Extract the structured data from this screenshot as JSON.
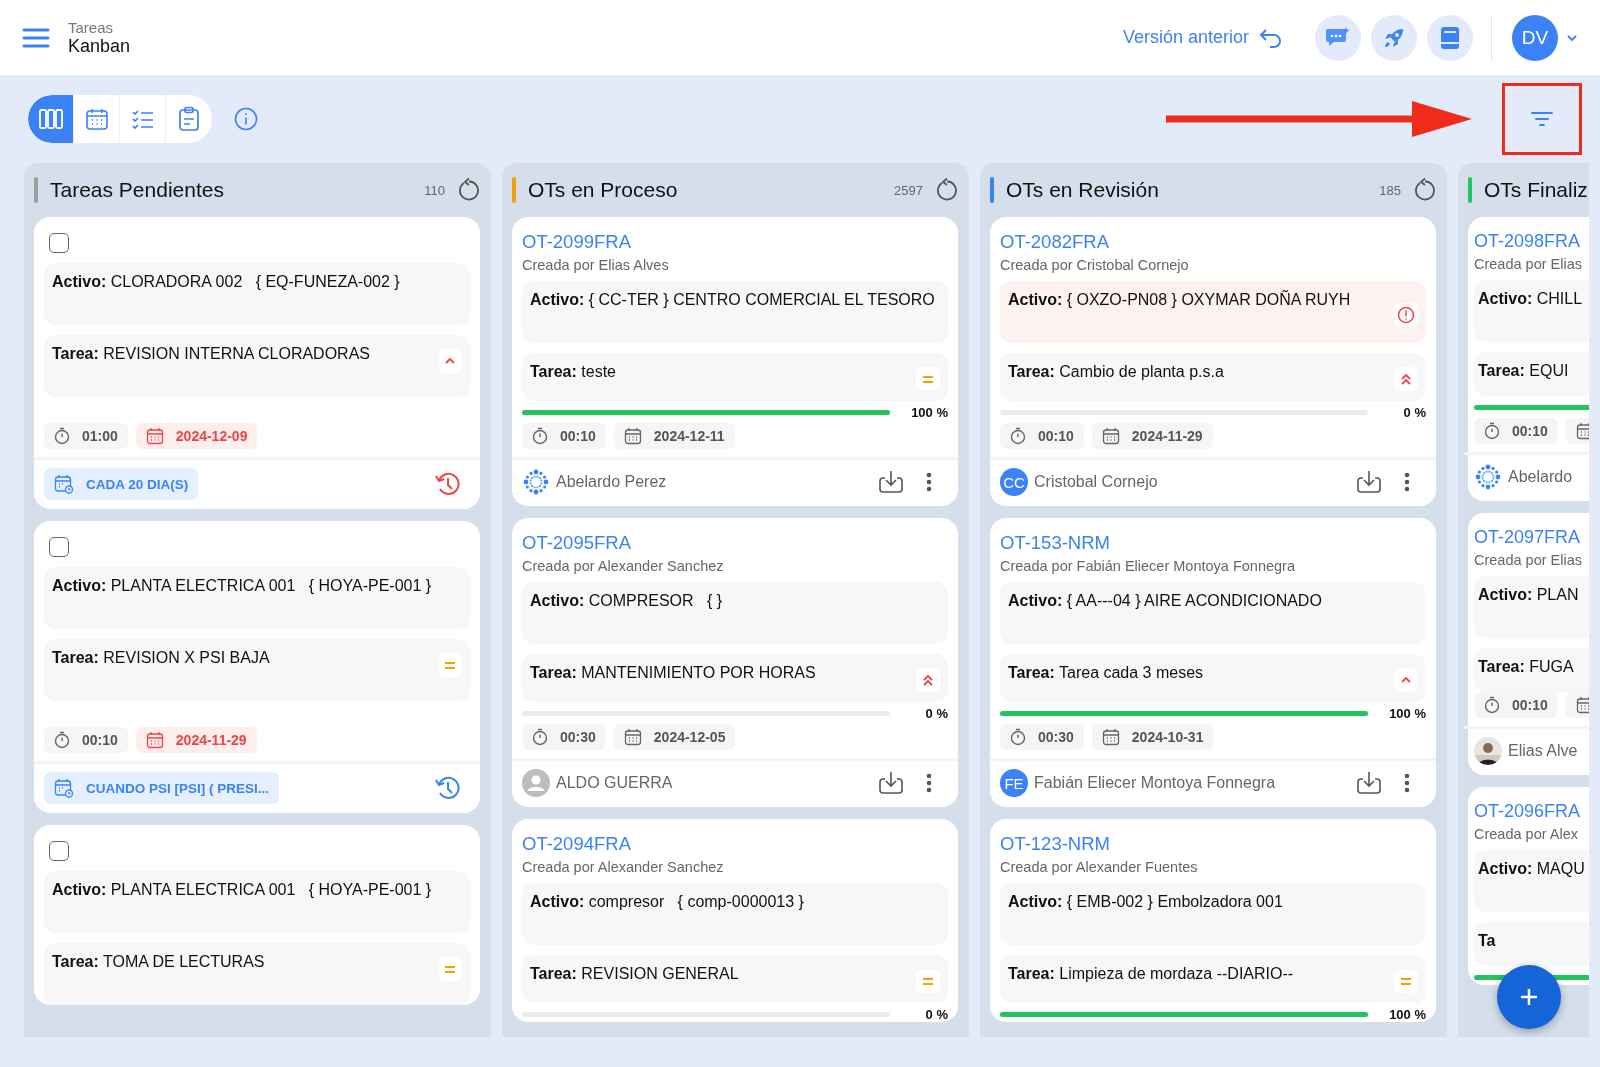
{
  "header": {
    "section": "Tareas",
    "title": "Kanban",
    "previous_version": "Versión anterior",
    "user_initials": "DV"
  },
  "toolbar": {
    "views": [
      {
        "kind": "board",
        "selected": true
      },
      {
        "kind": "calendar",
        "selected": false
      },
      {
        "kind": "checklist",
        "selected": false
      },
      {
        "kind": "clipboard",
        "selected": false
      }
    ]
  },
  "columns": [
    {
      "title": "Tareas Pendientes",
      "count": "110",
      "color": "#9e9e9e",
      "cards": [
        {
          "kind": "task",
          "checked": false,
          "activo": {
            "label": "Activo:",
            "value": "CLORADORA 002   { EQ-FUNEZA-002 }",
            "alert": false
          },
          "tarea": {
            "label": "Tarea:",
            "value": "REVISION INTERNA CLORADORAS",
            "kind": "up"
          },
          "time": "01:00",
          "date": "2024-12-09",
          "overdue": true,
          "recurrence": "CADA 20 DIA(S)",
          "history_alert": true
        },
        {
          "kind": "task",
          "checked": false,
          "activo": {
            "label": "Activo:",
            "value": "PLANTA ELECTRICA 001   { HOYA-PE-001 }",
            "alert": false
          },
          "tarea": {
            "label": "Tarea:",
            "value": "REVISION X PSI BAJA",
            "kind": "medium"
          },
          "time": "00:10",
          "date": "2024-11-29",
          "overdue": true,
          "recurrence": "CUANDO PSI [PSI] ( PRESI...",
          "history_alert": false
        },
        {
          "kind": "task",
          "checked": false,
          "activo": {
            "label": "Activo:",
            "value": "PLANTA ELECTRICA 001   { HOYA-PE-001 }",
            "alert": false
          },
          "tarea": {
            "label": "Tarea:",
            "value": "TOMA DE LECTURAS",
            "kind": "medium"
          }
        }
      ]
    },
    {
      "title": "OTs en Proceso",
      "count": "2597",
      "color": "#f59e0b",
      "cards": [
        {
          "kind": "order",
          "code": "OT-2099FRA",
          "creator": "Creada por Elias Alves",
          "activo": {
            "label": "Activo:",
            "value": "{ CC-TER } CENTRO COMERCIAL EL TESORO",
            "alert": false
          },
          "tarea": {
            "label": "Tarea:",
            "value": "teste",
            "kind": "medium"
          },
          "level": 1,
          "percent": "100 %",
          "time": "00:10",
          "date": "2024-12-11",
          "overdue": false,
          "assignee": {
            "kind": "dots",
            "name": "Abelardo Perez"
          },
          "actions": true
        },
        {
          "kind": "order",
          "code": "OT-2095FRA",
          "creator": "Creada por Alexander Sanchez",
          "activo": {
            "label": "Activo:",
            "value": "COMPRESOR   { }",
            "alert": false
          },
          "tarea": {
            "label": "Tarea:",
            "value": "MANTENIMIENTO POR HORAS",
            "kind": "high"
          },
          "level": 0,
          "percent": "0 %",
          "time": "00:30",
          "date": "2024-12-05",
          "overdue": false,
          "assignee": {
            "kind": "person",
            "name": "ALDO GUERRA"
          },
          "actions": true
        },
        {
          "kind": "order",
          "code": "OT-2094FRA",
          "creator": "Creada por Alexander Sanchez",
          "activo": {
            "label": "Activo:",
            "value": "compresor   { comp-0000013 }",
            "alert": false
          },
          "tarea": {
            "label": "Tarea:",
            "value": "REVISION GENERAL",
            "kind": "medium"
          },
          "level": 0,
          "percent": "0 %"
        }
      ]
    },
    {
      "title": "OTs en Revisión",
      "count": "185",
      "color": "#3b82f6",
      "cards": [
        {
          "kind": "order",
          "code": "OT-2082FRA",
          "creator": "Creada por Cristobal Cornejo",
          "activo": {
            "label": "Activo:",
            "value": "{ OXZO-PN08 } OXYMAR DOÑA RUYH",
            "alert": true
          },
          "tarea": {
            "label": "Tarea:",
            "value": "Cambio de planta p.s.a",
            "kind": "high"
          },
          "level": 0,
          "percent": "0 %",
          "time": "00:10",
          "date": "2024-11-29",
          "overdue": false,
          "assignee": {
            "kind": "initials",
            "initials": "CC",
            "name": "Cristobal Cornejo"
          },
          "actions": true
        },
        {
          "kind": "order",
          "code": "OT-153-NRM",
          "creator": "Creada por Fabián Eliecer Montoya Fonnegra",
          "activo": {
            "label": "Activo:",
            "value": "{ AA---04 } AIRE ACONDICIONADO",
            "alert": false
          },
          "tarea": {
            "label": "Tarea:",
            "value": "Tarea cada 3 meses",
            "kind": "up"
          },
          "level": 1,
          "percent": "100 %",
          "time": "00:30",
          "date": "2024-10-31",
          "overdue": false,
          "assignee": {
            "kind": "initials",
            "initials": "FE",
            "name": "Fabián Eliecer Montoya Fonnegra"
          },
          "actions": true
        },
        {
          "kind": "order",
          "code": "OT-123-NRM",
          "creator": "Creada por Alexander Fuentes",
          "activo": {
            "label": "Activo:",
            "value": "{ EMB-002 } Embolzadora 001",
            "alert": false
          },
          "tarea": {
            "label": "Tarea:",
            "value": "Limpieza de mordaza --DIARIO--",
            "kind": "medium"
          },
          "level": 1,
          "percent": "100 %"
        }
      ]
    },
    {
      "title": "OTs Finaliz",
      "color": "#22c55e",
      "cards": [
        {
          "kind": "order",
          "code": "OT-2098FRA",
          "creator": "Creada por Elias",
          "activo": {
            "label": "Activo:",
            "value": "CHILL"
          },
          "tarea": {
            "label": "Tarea:",
            "value": "EQUI"
          },
          "level": 1,
          "time": "00:10",
          "overdue": false,
          "assignee": {
            "kind": "dots",
            "name": "Abelardo"
          }
        },
        {
          "kind": "order",
          "code": "OT-2097FRA",
          "creator": "Creada por Elias",
          "activo": {
            "label": "Activo:",
            "value": "PLAN"
          },
          "tarea": {
            "label": "Tarea:",
            "value": "FUGA"
          },
          "time": "00:10",
          "overdue": false,
          "assignee": {
            "name": "Elias Alve"
          }
        },
        {
          "kind": "order",
          "code": "OT-2096FRA",
          "creator": "Creada por Alex",
          "activo": {
            "label": "Activo:",
            "value": "MAQU"
          },
          "tarea": {
            "label": "Ta"
          },
          "level": 1
        }
      ]
    }
  ]
}
